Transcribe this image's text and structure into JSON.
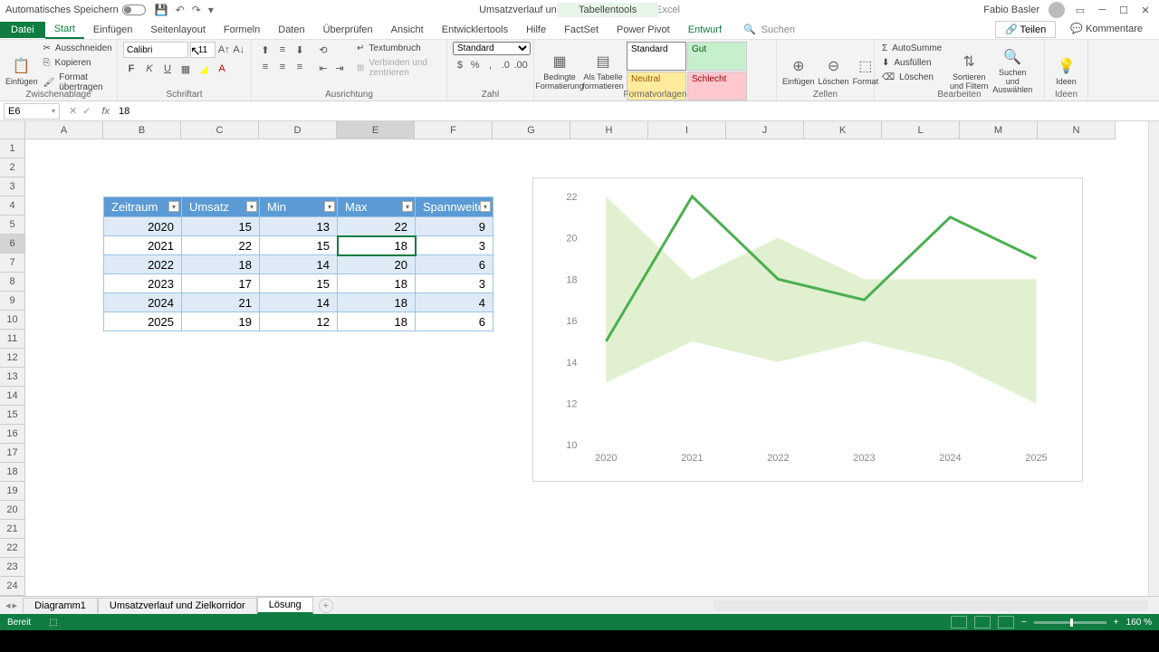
{
  "titlebar": {
    "autosave": "Automatisches Speichern",
    "filename": "Umsatzverlauf und Zielkorridor Grafik",
    "app": "Excel",
    "context_tool": "Tabellentools",
    "user": "Fabio Basler"
  },
  "tabs": {
    "file": "Datei",
    "list": [
      "Start",
      "Einfügen",
      "Seitenlayout",
      "Formeln",
      "Daten",
      "Überprüfen",
      "Ansicht",
      "Entwicklertools",
      "Hilfe",
      "FactSet",
      "Power Pivot",
      "Entwurf"
    ],
    "active": "Start",
    "context": "Entwurf",
    "search_placeholder": "Suchen",
    "share": "Teilen",
    "comments": "Kommentare"
  },
  "ribbon": {
    "clipboard": {
      "label": "Zwischenablage",
      "paste": "Einfügen",
      "cut": "Ausschneiden",
      "copy": "Kopieren",
      "format": "Format übertragen"
    },
    "font": {
      "label": "Schriftart",
      "name": "Calibri",
      "size": "11"
    },
    "align": {
      "label": "Ausrichtung",
      "wrap": "Textumbruch",
      "merge": "Verbinden und zentrieren"
    },
    "number": {
      "label": "Zahl",
      "format": "Standard"
    },
    "styles": {
      "label": "Formatvorlagen",
      "cond": "Bedingte Formatierung",
      "astable": "Als Tabelle formatieren",
      "std": "Standard",
      "gut": "Gut",
      "neutral": "Neutral",
      "schlecht": "Schlecht"
    },
    "cells": {
      "label": "Zellen",
      "insert": "Einfügen",
      "delete": "Löschen",
      "format": "Format"
    },
    "editing": {
      "label": "Bearbeiten",
      "sum": "AutoSumme",
      "fill": "Ausfüllen",
      "clear": "Löschen",
      "sort": "Sortieren und Filtern",
      "find": "Suchen und Auswählen"
    },
    "ideas": {
      "label": "Ideen",
      "btn": "Ideen"
    }
  },
  "fbar": {
    "cell": "E6",
    "value": "18"
  },
  "columns": [
    "A",
    "B",
    "C",
    "D",
    "E",
    "F",
    "G",
    "H",
    "I",
    "J",
    "K",
    "L",
    "M",
    "N"
  ],
  "sel_col": "E",
  "sel_row": 6,
  "table": {
    "headers": [
      "Zeitraum",
      "Umsatz",
      "Min",
      "Max",
      "Spannweite"
    ],
    "rows": [
      [
        "2020",
        "15",
        "13",
        "22",
        "9"
      ],
      [
        "2021",
        "22",
        "15",
        "18",
        "3"
      ],
      [
        "2022",
        "18",
        "14",
        "20",
        "6"
      ],
      [
        "2023",
        "17",
        "15",
        "18",
        "3"
      ],
      [
        "2024",
        "21",
        "14",
        "18",
        "4"
      ],
      [
        "2025",
        "19",
        "12",
        "18",
        "6"
      ]
    ]
  },
  "chart_data": {
    "type": "line",
    "categories": [
      "2020",
      "2021",
      "2022",
      "2023",
      "2024",
      "2025"
    ],
    "series": [
      {
        "name": "Umsatz",
        "values": [
          15,
          22,
          18,
          17,
          21,
          19
        ],
        "color": "#4caf50",
        "kind": "line"
      },
      {
        "name": "Min",
        "values": [
          13,
          15,
          14,
          15,
          14,
          12
        ],
        "kind": "area-low"
      },
      {
        "name": "Max",
        "values": [
          22,
          18,
          20,
          18,
          18,
          18
        ],
        "kind": "area-high"
      }
    ],
    "y_ticks": [
      10,
      12,
      14,
      16,
      18,
      20,
      22
    ],
    "ylim": [
      10,
      22
    ],
    "band_color": "#dcedc8"
  },
  "sheets": {
    "list": [
      "Diagramm1",
      "Umsatzverlauf und Zielkorridor",
      "Lösung"
    ],
    "active": "Lösung"
  },
  "status": {
    "ready": "Bereit",
    "zoom": "160 %"
  }
}
